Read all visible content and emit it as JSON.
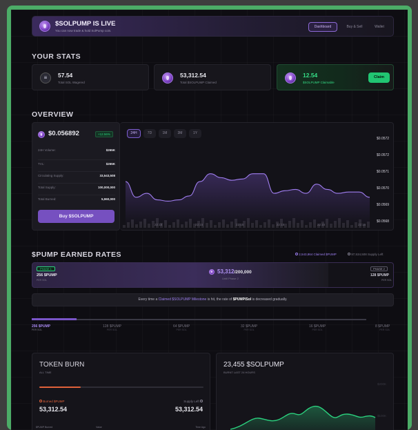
{
  "banner": {
    "title": "$SOLPUMP IS LIVE",
    "subtitle": "You can now trade & hold SolPump coin.",
    "nav": [
      "Dashboard",
      "Buy & Sell",
      "Wallet"
    ]
  },
  "stats": {
    "heading": "YOUR STATS",
    "items": [
      {
        "value": "57.54",
        "label": "Total SOL Wagered"
      },
      {
        "value": "53,312.54",
        "label": "Total $SOLPUMP Claimed"
      },
      {
        "value": "12.54",
        "label": "$SOLPUMP Claimable"
      }
    ],
    "claim_label": "Claim"
  },
  "overview": {
    "heading": "OVERVIEW",
    "price": "$0.056892",
    "change": "+12.56%",
    "rows": [
      {
        "k": "24H Volume:",
        "v": "$265K"
      },
      {
        "k": "TVL:",
        "v": "$265K"
      },
      {
        "k": "Circulating Supply:",
        "v": "33,543,508"
      },
      {
        "k": "Total Supply:",
        "v": "100,000,000"
      },
      {
        "k": "Total Burned:",
        "v": "5,960,000"
      }
    ],
    "buy_label": "Buy $SOLPUMP",
    "ranges": [
      "24H",
      "7D",
      "1M",
      "3M",
      "1Y"
    ]
  },
  "chart_data": {
    "type": "line",
    "y_ticks": [
      "$0.0572",
      "$0.0572",
      "$0.0571",
      "$0.0570",
      "$0.0569",
      "$0.0568"
    ],
    "x_ticks": [
      "22:15",
      "22:15",
      "22:15",
      "22:15",
      "22:15",
      "22:15"
    ],
    "values": [
      0.05697,
      0.05685,
      0.05688,
      0.05683,
      0.05682,
      0.05683,
      0.05686,
      0.05697,
      0.05703,
      0.057,
      0.05698,
      0.05699,
      0.05703,
      0.05703,
      0.05688,
      0.0569,
      0.05691,
      0.05688,
      0.05695,
      0.05691,
      0.05688,
      0.05689,
      0.05689,
      0.05685
    ],
    "ylim": [
      0.05668,
      0.05725
    ]
  },
  "rates": {
    "heading": "$PUMP EARNED RATES",
    "claimed_note": "2,543,864 Claimed $PUMP",
    "left_note": "97,534,508 Supply Left",
    "phase1": "PHASE 1",
    "phase1_rate": "256 $PUMP",
    "phase1_unit": "PER SOL",
    "progress": "53,312",
    "progress_total": "/200,000",
    "progress_sub": "Until Phase 2",
    "phase2": "PHASE 2",
    "phase2_rate": "128 $PUMP",
    "phase2_unit": "PER SOL",
    "info_pre": "Every time a ",
    "info_link": "Claimed $SOLPUMP Milestone",
    "info_mid": " is hit, the rate of ",
    "info_bold": "$PUMP/Sol",
    "info_post": " is decreased gradually.",
    "tiers": [
      {
        "rate": "256 $PUMP",
        "unit": "PER SOL"
      },
      {
        "rate": "128 $PUMP",
        "unit": "PER SOL"
      },
      {
        "rate": "64 $PUMP",
        "unit": "PER SOL"
      },
      {
        "rate": "32 $PUMP",
        "unit": "PER SOL"
      },
      {
        "rate": "16 $PUMP",
        "unit": "PER SOL"
      },
      {
        "rate": "8 $PUMP",
        "unit": "PER SOL"
      }
    ]
  },
  "burn": {
    "title": "TOKEN BURN",
    "sub": "ALL TIME",
    "burned_label": "Burned $PUMP",
    "burned_value": "53,312.54",
    "left_label": "Supply Left",
    "left_value": "53,312.54",
    "cols": [
      "$PUMP Burned",
      "Value",
      "Time Ago"
    ]
  },
  "burnt24": {
    "title": "23,455 $SOLPUMP",
    "sub": "BURNT LAST 24 HOURS",
    "ticks": [
      "$200K",
      "$100K"
    ]
  },
  "colors": {
    "accent": "#7b54c4",
    "green": "#2bd17e",
    "bg": "#0e0d12"
  }
}
